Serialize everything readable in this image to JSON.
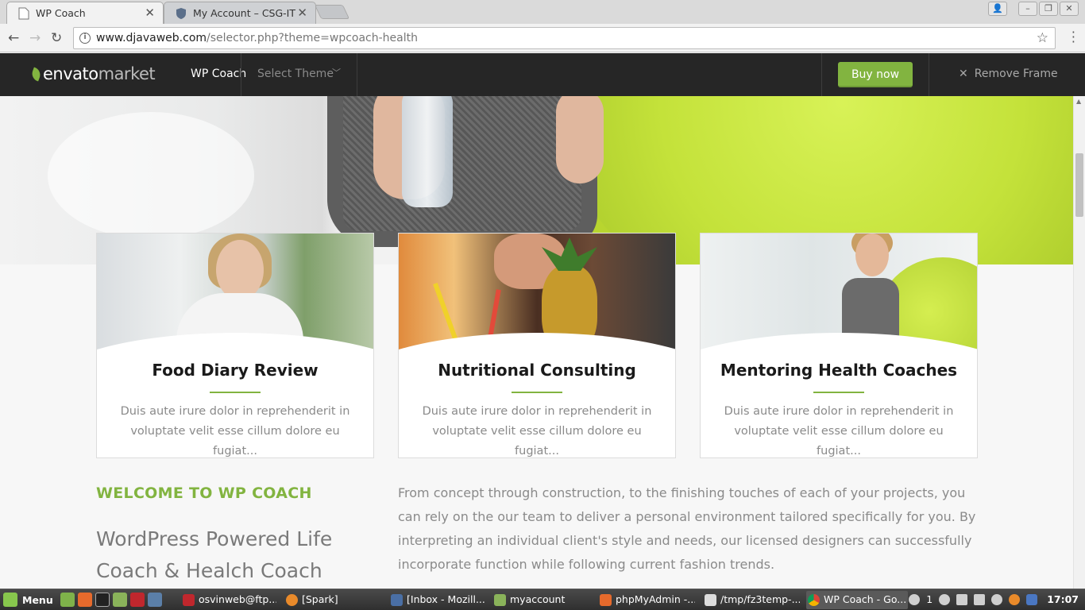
{
  "browser": {
    "tabs": [
      {
        "title": "WP Coach",
        "active": true
      },
      {
        "title": "My Account – CSG-IT",
        "active": false
      }
    ],
    "url_domain": "www.djavaweb.com",
    "url_path": "/selector.php?theme=wpcoach-health"
  },
  "envato_bar": {
    "logo_envato": "envato",
    "logo_market": "market",
    "current_theme": "WP Coach",
    "select_theme": "Select Theme",
    "buy_now": "Buy now",
    "remove_frame": "Remove Frame",
    "accent_color": "#82b440"
  },
  "cards": [
    {
      "title": "Food Diary Review",
      "desc": "Duis aute irure dolor in reprehenderit in voluptate velit esse cillum dolore eu fugiat..."
    },
    {
      "title": "Nutritional Consulting",
      "desc": "Duis aute irure dolor in reprehenderit in voluptate velit esse cillum dolore eu fugiat..."
    },
    {
      "title": "Mentoring Health Coaches",
      "desc": "Duis aute irure dolor in reprehenderit in voluptate velit esse cillum dolore eu fugiat..."
    }
  ],
  "welcome": {
    "label": "WELCOME TO WP COACH",
    "headline": "WordPress Powered Life Coach & Healch Coach",
    "body": "From concept through construction, to the finishing touches of each of your projects, you can rely on the our team to deliver a personal environment tailored specifically for you. By interpreting an individual client's style and needs, our licensed designers can successfully incorporate function while following current fashion trends."
  },
  "taskbar": {
    "menu_label": "Menu",
    "items": [
      {
        "label": "osvinweb@ftp...."
      },
      {
        "label": "[Spark]"
      },
      {
        "label": "[Inbox - Mozill..."
      },
      {
        "label": "myaccount"
      },
      {
        "label": "phpMyAdmin -..."
      },
      {
        "label": "/tmp/fz3temp-..."
      },
      {
        "label": "WP Coach - Go..."
      }
    ],
    "tray_count": "1",
    "clock": "17:07"
  }
}
